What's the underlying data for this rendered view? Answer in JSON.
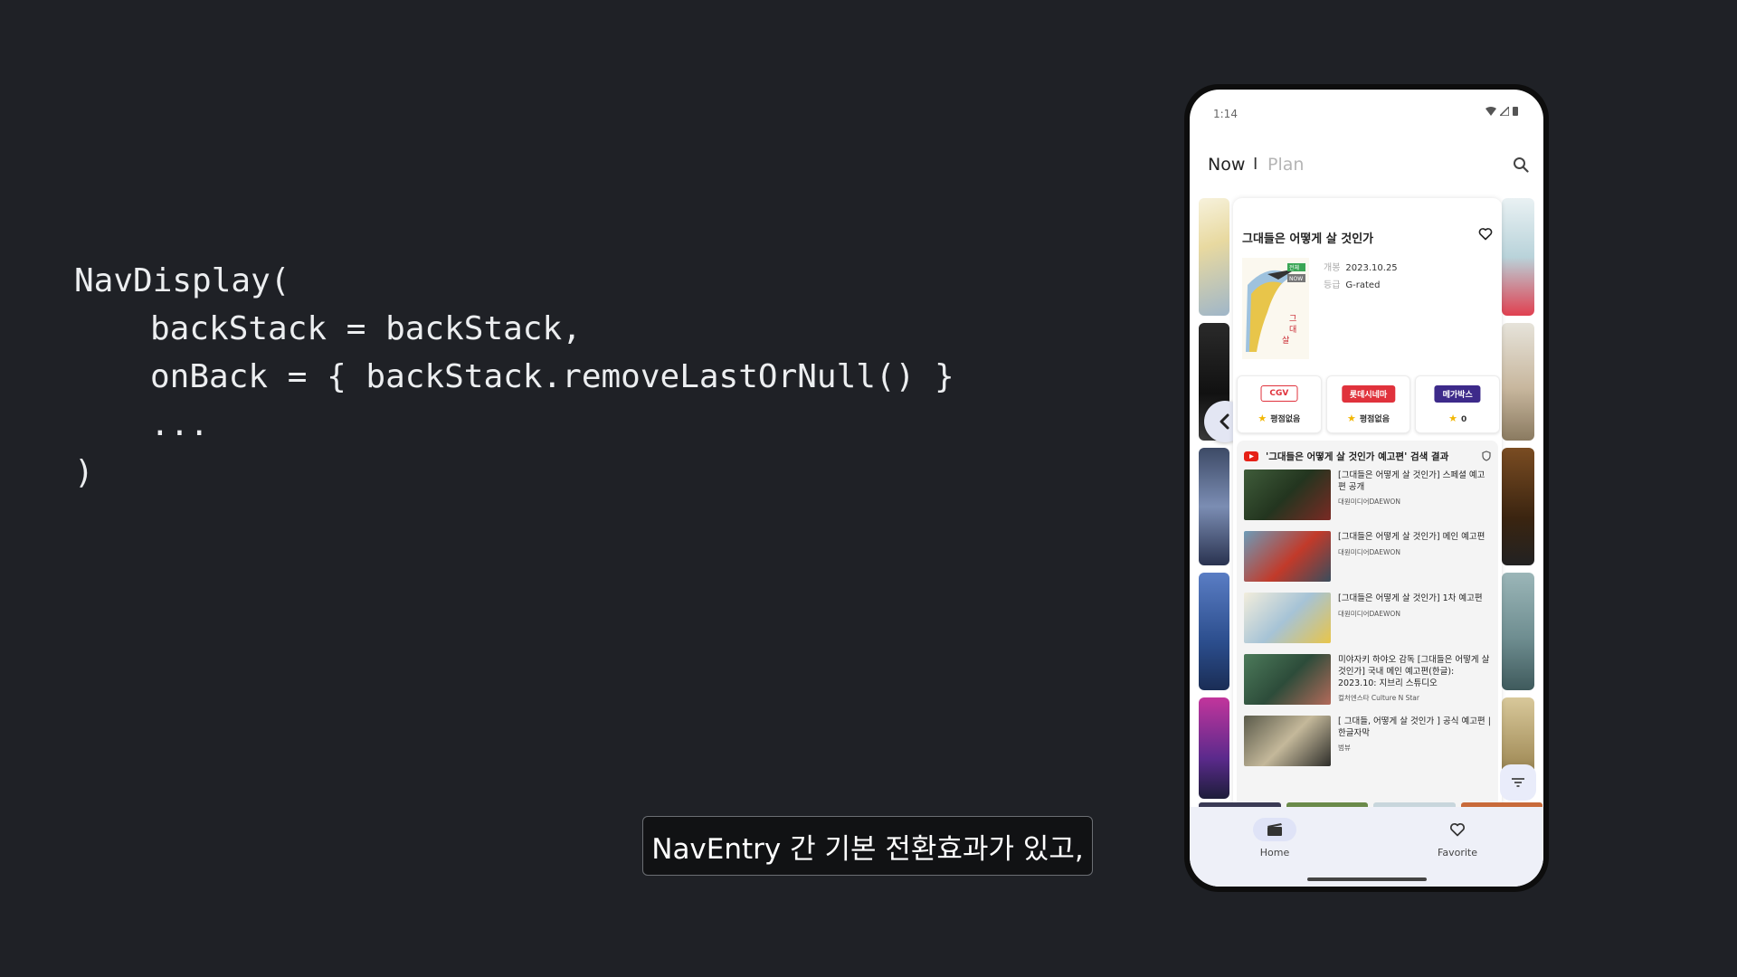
{
  "code": {
    "lines": [
      "NavDisplay(",
      "backStack = backStack,",
      "onBack = { backStack.removeLastOrNull() }",
      "...",
      ")"
    ]
  },
  "caption": "NavEntry 간 기본 전환효과가 있고,",
  "phone": {
    "status_time": "1:14",
    "tabs": {
      "now": "Now",
      "separator": "I",
      "plan": "Plan"
    },
    "movie": {
      "title": "그대들은 어떻게 살 것인가",
      "release_key": "개봉",
      "release_value": "2023.10.25",
      "grade_key": "등급",
      "grade_value": "G-rated",
      "poster_badges": [
        "전체",
        "NOW"
      ]
    },
    "theaters": [
      {
        "name": "CGV",
        "rating": "평점없음",
        "color": "#e0323c"
      },
      {
        "name": "롯데시네마",
        "rating": "평점없음",
        "color": "#e0323c"
      },
      {
        "name": "메가박스",
        "rating": "0",
        "color": "#3d2a8a"
      }
    ],
    "youtube": {
      "header": "'그대들은 어떻게 살 것인가 예고편' 검색 결과",
      "videos": [
        {
          "title": "[그대들은 어떻게 살 것인가] 스페셜 예고편 공개",
          "channel": "대원미디어DAEWON"
        },
        {
          "title": "[그대들은 어떻게 살 것인가] 메인 예고편",
          "channel": "대원미디어DAEWON"
        },
        {
          "title": "[그대들은 어떻게 살 것인가] 1차 예고편",
          "channel": "대원미디어DAEWON"
        },
        {
          "title": "미야자키 하야오 감독 [그대들은 어떻게 살 것인가] 국내 메인 예고편(한글): 2023.10: 지브리 스튜디오",
          "channel": "컬처엔스타 Culture N Star"
        },
        {
          "title": "[ 그대들, 어떻게 살 것인가 ] 공식 예고편 | 한글자막",
          "channel": "범뷰"
        }
      ]
    },
    "bottom_nav": {
      "home": "Home",
      "favorite": "Favorite"
    },
    "colors": {
      "accent": "#3d2a8a",
      "nav_bg": "#eef0f8"
    }
  }
}
